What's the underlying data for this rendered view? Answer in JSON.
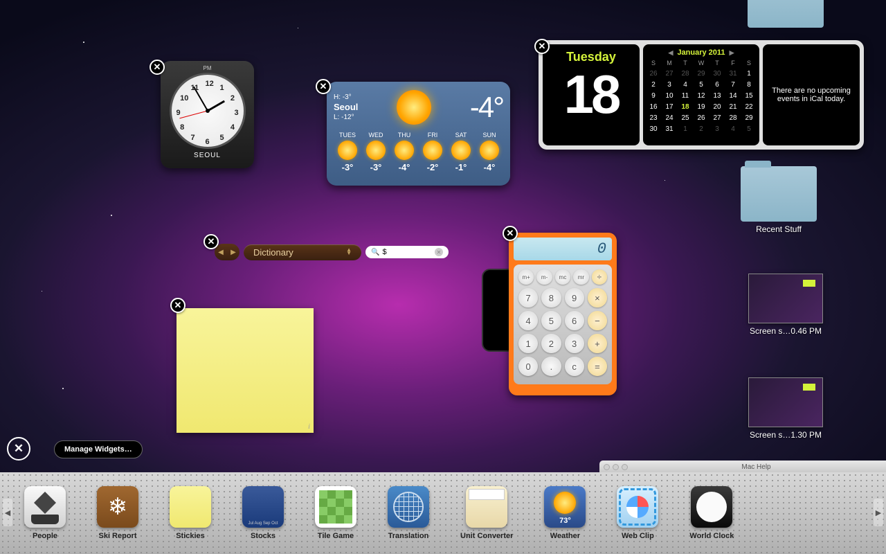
{
  "clock": {
    "ampm": "PM",
    "city": "SEOUL",
    "numbers": [
      "12",
      "1",
      "2",
      "3",
      "4",
      "5",
      "6",
      "7",
      "8",
      "9",
      "10",
      "11"
    ]
  },
  "weather": {
    "city": "Seoul",
    "hi": "H: -3°",
    "lo": "L: -12°",
    "now": "-4°",
    "days": [
      {
        "d": "TUES",
        "t": "-3°"
      },
      {
        "d": "WED",
        "t": "-3°"
      },
      {
        "d": "THU",
        "t": "-4°"
      },
      {
        "d": "FRI",
        "t": "-2°"
      },
      {
        "d": "SAT",
        "t": "-1°"
      },
      {
        "d": "SUN",
        "t": "-4°"
      }
    ]
  },
  "calendar": {
    "dow": "Tuesday",
    "date": "18",
    "month": "January 2011",
    "heads": [
      "S",
      "M",
      "T",
      "W",
      "T",
      "F",
      "S"
    ],
    "cells": [
      {
        "n": "26",
        "dim": true
      },
      {
        "n": "27",
        "dim": true
      },
      {
        "n": "28",
        "dim": true
      },
      {
        "n": "29",
        "dim": true
      },
      {
        "n": "30",
        "dim": true
      },
      {
        "n": "31",
        "dim": true
      },
      {
        "n": "1"
      },
      {
        "n": "2"
      },
      {
        "n": "3"
      },
      {
        "n": "4"
      },
      {
        "n": "5"
      },
      {
        "n": "6"
      },
      {
        "n": "7"
      },
      {
        "n": "8"
      },
      {
        "n": "9"
      },
      {
        "n": "10"
      },
      {
        "n": "11"
      },
      {
        "n": "12"
      },
      {
        "n": "13"
      },
      {
        "n": "14"
      },
      {
        "n": "15"
      },
      {
        "n": "16"
      },
      {
        "n": "17"
      },
      {
        "n": "18",
        "today": true
      },
      {
        "n": "19"
      },
      {
        "n": "20"
      },
      {
        "n": "21"
      },
      {
        "n": "22"
      },
      {
        "n": "23"
      },
      {
        "n": "24"
      },
      {
        "n": "25"
      },
      {
        "n": "26"
      },
      {
        "n": "27"
      },
      {
        "n": "28"
      },
      {
        "n": "29"
      },
      {
        "n": "30"
      },
      {
        "n": "31"
      },
      {
        "n": "1",
        "dim": true
      },
      {
        "n": "2",
        "dim": true
      },
      {
        "n": "3",
        "dim": true
      },
      {
        "n": "4",
        "dim": true
      },
      {
        "n": "5",
        "dim": true
      }
    ],
    "events": "There are no upcoming events in iCal today."
  },
  "dictionary": {
    "mode": "Dictionary",
    "query": "$"
  },
  "calculator": {
    "display": "0",
    "buttons": [
      {
        "l": "m+",
        "c": "mem"
      },
      {
        "l": "m-",
        "c": "mem"
      },
      {
        "l": "mc",
        "c": "mem"
      },
      {
        "l": "mr",
        "c": "mem"
      },
      {
        "l": "÷",
        "c": "op"
      },
      {
        "l": "7"
      },
      {
        "l": "8"
      },
      {
        "l": "9"
      },
      {
        "l": "×",
        "c": "op"
      },
      {
        "l": "4"
      },
      {
        "l": "5"
      },
      {
        "l": "6"
      },
      {
        "l": "−",
        "c": "op"
      },
      {
        "l": "1"
      },
      {
        "l": "2"
      },
      {
        "l": "3"
      },
      {
        "l": "+",
        "c": "op"
      },
      {
        "l": "0",
        "c": "zero"
      },
      {
        "l": ".",
        "c": ""
      },
      {
        "l": "c"
      },
      {
        "l": "=",
        "c": "eq op"
      }
    ]
  },
  "desktop": {
    "folder": "Recent Stuff",
    "shot1": "Screen s…0.46 PM",
    "shot2": "Screen s…1.30 PM"
  },
  "manage": "Manage Widgets…",
  "machelp": "Mac Help",
  "bar": {
    "weather_temp": "73°",
    "items": [
      {
        "label": "People",
        "cls": "bi-people"
      },
      {
        "label": "Ski Report",
        "cls": "bi-ski"
      },
      {
        "label": "Stickies",
        "cls": "bi-stickies"
      },
      {
        "label": "Stocks",
        "cls": "bi-stocks"
      },
      {
        "label": "Tile Game",
        "cls": "bi-tile"
      },
      {
        "label": "Translation",
        "cls": "bi-trans"
      },
      {
        "label": "Unit Converter",
        "cls": "bi-unit"
      },
      {
        "label": "Weather",
        "cls": "bi-weather"
      },
      {
        "label": "Web Clip",
        "cls": "bi-webclip"
      },
      {
        "label": "World Clock",
        "cls": "bi-clock"
      }
    ]
  }
}
